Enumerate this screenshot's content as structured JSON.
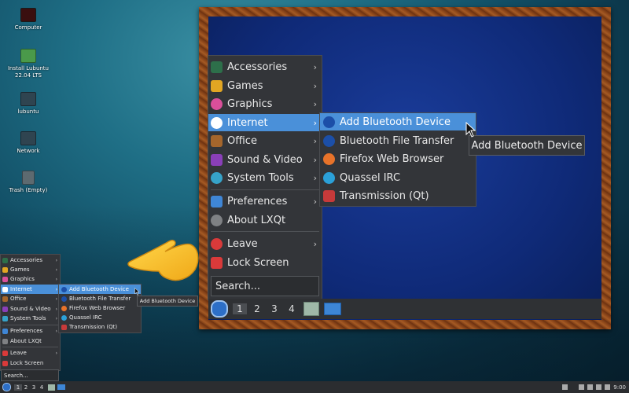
{
  "desktop": {
    "icons": [
      {
        "label": "Computer",
        "icon": "monitor-icon"
      },
      {
        "label": "Install Lubuntu 22.04 LTS",
        "icon": "install-icon"
      },
      {
        "label": "lubuntu",
        "icon": "home-folder-icon"
      },
      {
        "label": "Network",
        "icon": "network-folder-icon"
      },
      {
        "label": "Trash (Empty)",
        "icon": "trash-icon"
      }
    ]
  },
  "menu": {
    "items": [
      {
        "label": "Accessories",
        "icon": "accessories-icon",
        "color": "#2d6f4a"
      },
      {
        "label": "Games",
        "icon": "games-icon",
        "color": "#e2a623"
      },
      {
        "label": "Graphics",
        "icon": "graphics-icon",
        "color": "#d94f9a"
      },
      {
        "label": "Internet",
        "icon": "internet-icon",
        "color": "#2f78d6"
      },
      {
        "label": "Office",
        "icon": "office-icon",
        "color": "#a5662c"
      },
      {
        "label": "Sound & Video",
        "icon": "sound-video-icon",
        "color": "#8a3fb8"
      },
      {
        "label": "System Tools",
        "icon": "system-tools-icon",
        "color": "#36a3c9"
      },
      {
        "label": "Preferences",
        "icon": "preferences-icon",
        "color": "#3f86d6"
      },
      {
        "label": "About LXQt",
        "icon": "info-icon",
        "color": "#7f8184"
      },
      {
        "label": "Leave",
        "icon": "power-icon",
        "color": "#d93a3a"
      },
      {
        "label": "Lock Screen",
        "icon": "lock-icon",
        "color": "#d93a3a"
      }
    ],
    "search_placeholder": "Search...",
    "highlighted": "Internet"
  },
  "internet_submenu": {
    "items": [
      {
        "label": "Add Bluetooth Device",
        "icon": "bluetooth-icon"
      },
      {
        "label": "Bluetooth File Transfer",
        "icon": "bluetooth-icon"
      },
      {
        "label": "Firefox Web Browser",
        "icon": "firefox-icon"
      },
      {
        "label": "Quassel IRC",
        "icon": "quassel-icon"
      },
      {
        "label": "Transmission (Qt)",
        "icon": "transmission-icon"
      }
    ],
    "highlighted": "Add Bluetooth Device"
  },
  "tooltip": {
    "text": "Add Bluetooth Device"
  },
  "panel": {
    "workspaces": [
      "1",
      "2",
      "3",
      "4"
    ],
    "active_workspace": "1",
    "clock": "9:00"
  },
  "colors": {
    "menu_bg": "#333539",
    "highlight": "#4a90d9",
    "frame_wood": "#8a4519"
  }
}
